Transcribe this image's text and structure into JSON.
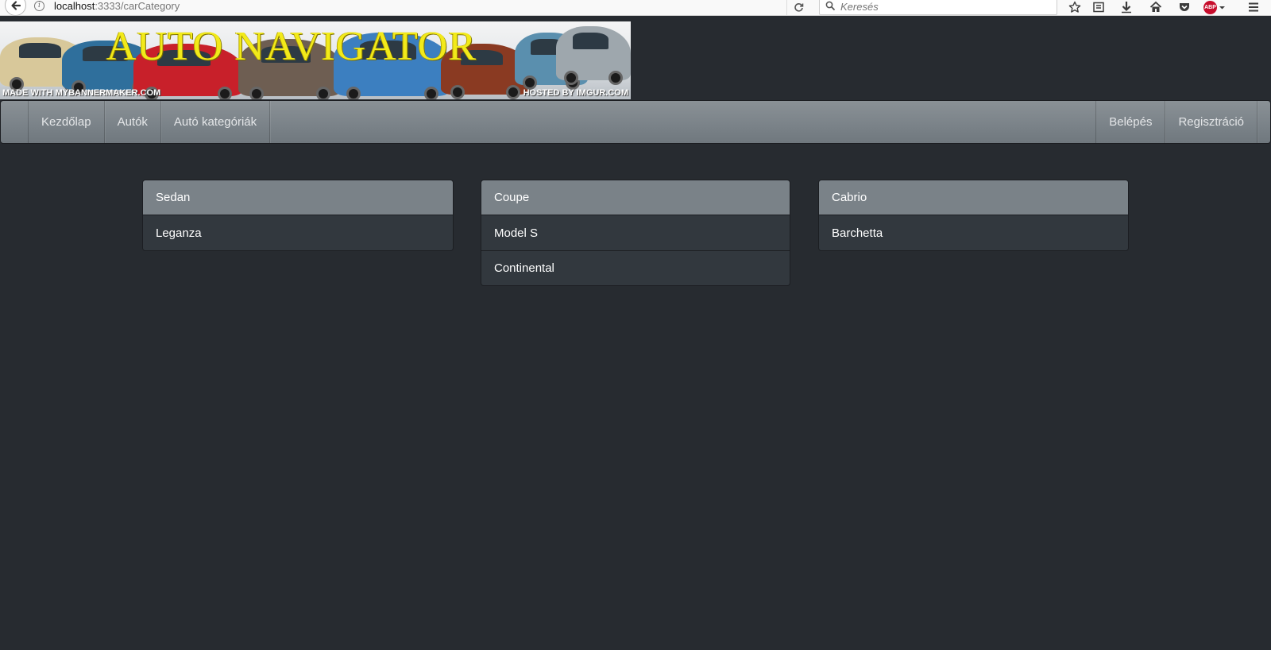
{
  "browser": {
    "url_host": "localhost",
    "url_rest": ":3333/carCategory",
    "search_placeholder": "Keresés",
    "abp_label": "ABP"
  },
  "banner": {
    "title": "AUTO NAVIGATOR",
    "footer_left": "MADE WITH MYBANNERMAKER.COM",
    "footer_right": "HOSTED BY IMGUR.COM"
  },
  "nav": {
    "left": [
      "Kezdőlap",
      "Autók",
      "Autó kategóriák"
    ],
    "right": [
      "Belépés",
      "Regisztráció"
    ]
  },
  "categories": [
    {
      "name": "Sedan",
      "cars": [
        "Leganza"
      ]
    },
    {
      "name": "Coupe",
      "cars": [
        "Model S",
        "Continental"
      ]
    },
    {
      "name": "Cabrio",
      "cars": [
        "Barchetta"
      ]
    }
  ]
}
